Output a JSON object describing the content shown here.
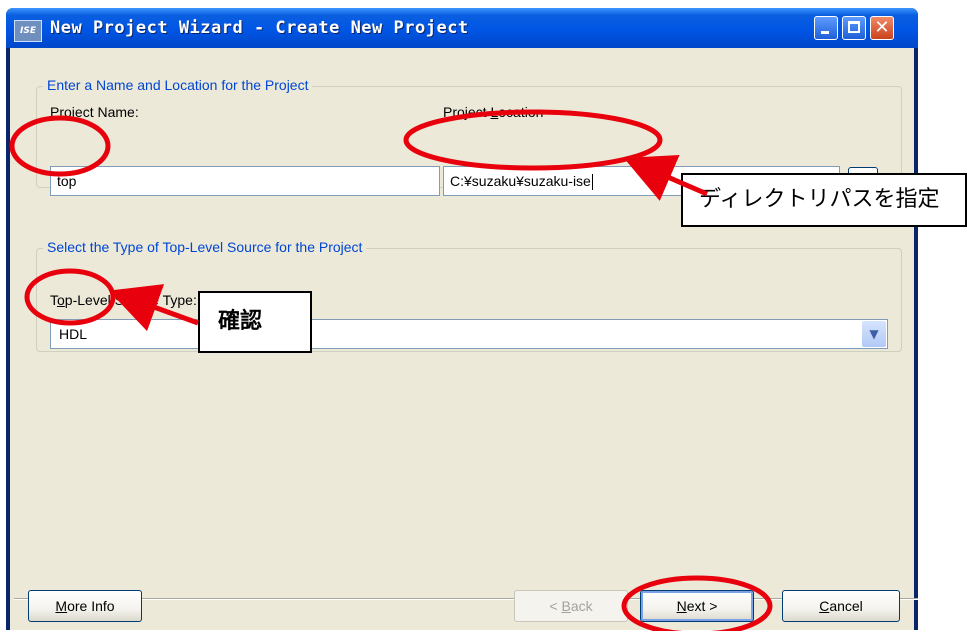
{
  "window": {
    "title": "New Project Wizard - Create New Project",
    "app_icon_text": "ISE"
  },
  "section_name_location": {
    "title": "Enter a Name and Location for the Project",
    "project_name_label_first": "P",
    "project_name_label_rest": "roject Name:",
    "project_name_value": "top",
    "project_location_label_main": "Project ",
    "project_location_label_first": "L",
    "project_location_label_rest": "ocation",
    "project_location_value": "C:¥suzaku¥suzaku-ise",
    "browse_label": "..."
  },
  "section_source_type": {
    "title": "Select the Type of Top-Level Source for the Project",
    "source_type_label_pre": "T",
    "source_type_label_first": "o",
    "source_type_label_rest": "p-Level Source Type:",
    "source_type_value": "HDL"
  },
  "buttons": {
    "more_info_first": "M",
    "more_info_rest": "ore Info",
    "back_prefix": "< ",
    "back_first": "B",
    "back_rest": "ack",
    "next_first": "N",
    "next_rest": "ext >",
    "cancel_first": "C",
    "cancel_rest": "ancel"
  },
  "annotations": {
    "directory_callout": "ディレクトリパスを指定",
    "confirm_callout": "確認",
    "highlight_color": "#e8000d"
  }
}
